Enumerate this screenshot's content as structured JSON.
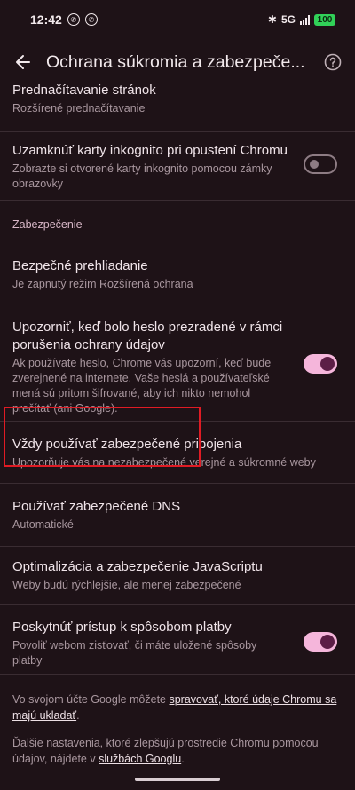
{
  "status": {
    "time": "12:42",
    "network": "5G",
    "battery": "100"
  },
  "app_bar": {
    "title": "Ochrana súkromia a zabezpeče..."
  },
  "items": [
    {
      "title": "Prednačítavanie stránok",
      "subtitle": "Rozšírené prednačítavanie"
    },
    {
      "title": "Uzamknúť karty inkognito pri opustení Chromu",
      "subtitle": "Zobrazte si otvorené karty inkognito pomocou zámky obrazovky",
      "toggle": false
    },
    {
      "section": "Zabezpečenie"
    },
    {
      "title": "Bezpečné prehliadanie",
      "subtitle": "Je zapnutý režim Rozšírená ochrana"
    },
    {
      "title": "Upozorniť, keď bolo heslo prezradené v rámci porušenia ochrany údajov",
      "subtitle": "Ak používate heslo, Chrome vás upozorní, keď bude zverejnené na internete. Vaše heslá a používateľské mená sú pritom šifrované, aby ich nikto nemohol prečítať (ani Google).",
      "toggle": true
    },
    {
      "title": "Vždy používať zabezpečené pripojenia",
      "subtitle": "Upozorňuje vás na nezabezpečené verejné a súkromné weby"
    },
    {
      "title": "Používať zabezpečené DNS",
      "subtitle": "Automatické"
    },
    {
      "title": "Optimalizácia a zabezpečenie JavaScriptu",
      "subtitle": "Weby budú rýchlejšie, ale menej zabezpečené"
    },
    {
      "title": "Poskytnúť prístup k spôsobom platby",
      "subtitle": "Povoliť webom zisťovať, či máte uložené spôsoby platby",
      "toggle": true
    }
  ],
  "footer": {
    "p1_pre": "Vo svojom účte Google môžete ",
    "p1_link": "spravovať, ktoré údaje Chromu sa majú ukladať",
    "p1_post": ".",
    "p2_pre": "Ďalšie nastavenia, ktoré zlepšujú prostredie Chromu pomocou údajov, nájdete v ",
    "p2_link": "službách Googlu",
    "p2_post": "."
  },
  "colors": {
    "background": "#1e1217",
    "toggle_on": "#f5b6db",
    "highlight": "#e01b24",
    "section_header": "#d8b7c7"
  }
}
